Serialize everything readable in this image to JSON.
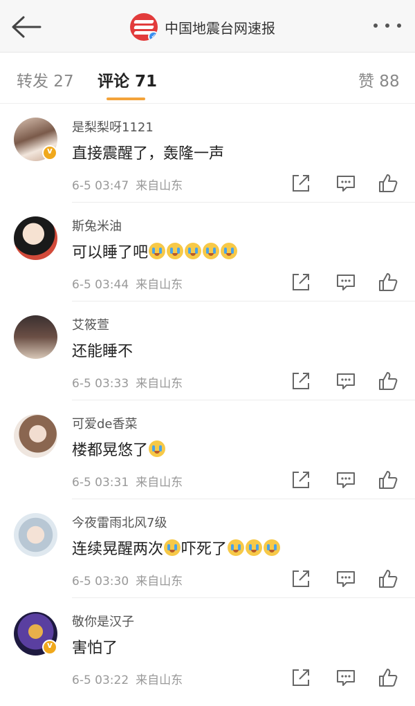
{
  "header": {
    "title": "中国地震台网速报",
    "back_icon": "back-arrow-icon",
    "more_icon": "more-dots-icon",
    "logo_color": "#e23b3b"
  },
  "tabs": {
    "repost": "转发 27",
    "comment": "评论 71",
    "like": "赞 88",
    "active": "comment",
    "accent": "#f3a33a"
  },
  "comments": [
    {
      "username": "是梨梨呀1121",
      "text": "直接震醒了，轰隆一声",
      "emoji_count": 0,
      "after_emoji_text": "",
      "trailing_emoji": 0,
      "time": "6-5 03:47",
      "source": "来自山东",
      "verified": true
    },
    {
      "username": "斯兔米油",
      "text": "可以睡了吧",
      "emoji_count": 5,
      "after_emoji_text": "",
      "trailing_emoji": 0,
      "time": "6-5 03:44",
      "source": "来自山东",
      "verified": false
    },
    {
      "username": "艾筱萱",
      "text": "还能睡不",
      "emoji_count": 0,
      "after_emoji_text": "",
      "trailing_emoji": 0,
      "time": "6-5 03:33",
      "source": "来自山东",
      "verified": false
    },
    {
      "username": "可爱de香菜",
      "text": "楼都晃悠了",
      "emoji_count": 1,
      "after_emoji_text": "",
      "trailing_emoji": 0,
      "time": "6-5 03:31",
      "source": "来自山东",
      "verified": false
    },
    {
      "username": "今夜雷雨北风7级",
      "text": "连续晃醒两次",
      "emoji_count": 1,
      "after_emoji_text": "吓死了",
      "trailing_emoji": 3,
      "time": "6-5 03:30",
      "source": "来自山东",
      "verified": false
    },
    {
      "username": "敬你是汉子",
      "text": "害怕了",
      "emoji_count": 0,
      "after_emoji_text": "",
      "trailing_emoji": 0,
      "time": "6-5 03:22",
      "source": "来自山东",
      "verified": true
    }
  ],
  "icons": {
    "share": "share-icon",
    "comment": "comment-icon",
    "like": "like-icon",
    "emoji": "crying-emoji-icon"
  }
}
